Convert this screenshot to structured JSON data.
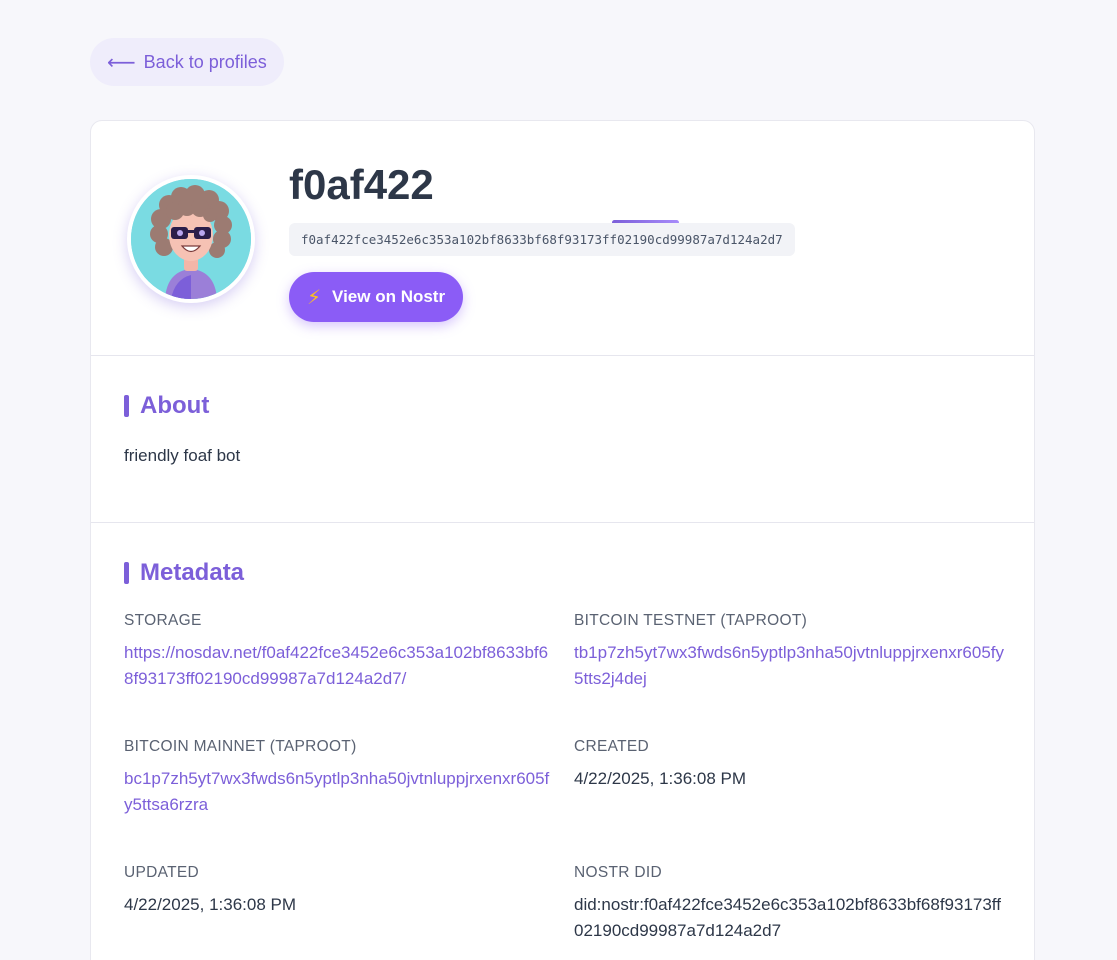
{
  "back": {
    "label": "Back to profiles",
    "arrow": "⟵"
  },
  "profile": {
    "name": "f0af422",
    "pubkey": "f0af422fce3452e6c353a102bf8633bf68f93173ff02190cd99987a7d124a2d7",
    "avatar_icon": "avatar-robot-icon",
    "nostr_button": {
      "icon": "⚡",
      "label": "View on Nostr"
    }
  },
  "about": {
    "title": "About",
    "text": "friendly foaf bot"
  },
  "metadata": {
    "title": "Metadata",
    "items": [
      {
        "label": "STORAGE",
        "value": "https://nosdav.net/f0af422fce3452e6c353a102bf8633bf68f93173ff02190cd99987a7d124a2d7/"
      },
      {
        "label": "BITCOIN TESTNET (TAPROOT)",
        "value": "tb1p7zh5yt7wx3fwds6n5yptlp3nha50jvtnluppjrxenxr605fy5tts2j4dej"
      },
      {
        "label": "BITCOIN MAINNET (TAPROOT)",
        "value": "bc1p7zh5yt7wx3fwds6n5yptlp3nha50jvtnluppjrxenxr605fy5ttsa6rzra"
      },
      {
        "label": "CREATED",
        "value": "4/22/2025, 1:36:08 PM"
      },
      {
        "label": "UPDATED",
        "value": "4/22/2025, 1:36:08 PM"
      },
      {
        "label": "NOSTR DID",
        "value": "did:nostr:f0af422fce3452e6c353a102bf8633bf68f93173ff02190cd99987a7d124a2d7"
      }
    ]
  },
  "colors": {
    "accent": "#7c5fd9",
    "button": "#8b5cf6",
    "background": "#f7f7fb"
  }
}
